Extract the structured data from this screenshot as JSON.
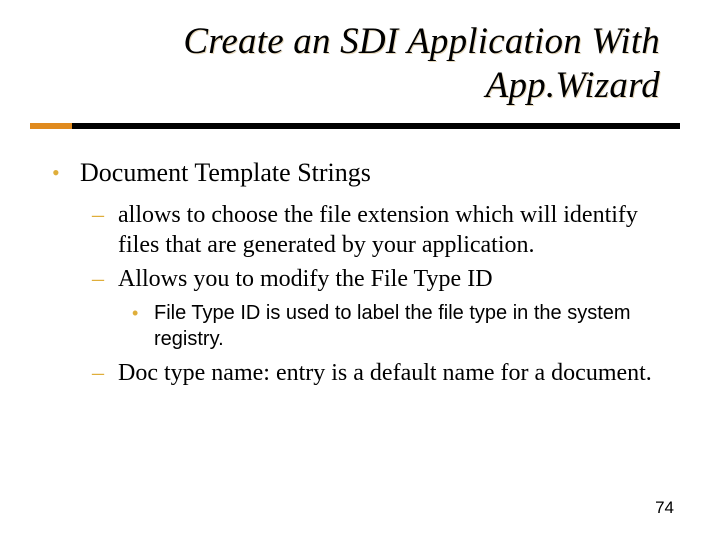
{
  "title_line1": "Create an SDI Application With",
  "title_line2": "App.Wizard",
  "bullet1": "Document Template Strings",
  "sub1": "allows to choose the file extension which will identify files that are generated by your application.",
  "sub2": "Allows you to modify the File Type ID",
  "subsub1": "File Type ID is used to label the file type in the system registry.",
  "sub3": "Doc type name: entry is a default name for a document.",
  "page_number": "74"
}
